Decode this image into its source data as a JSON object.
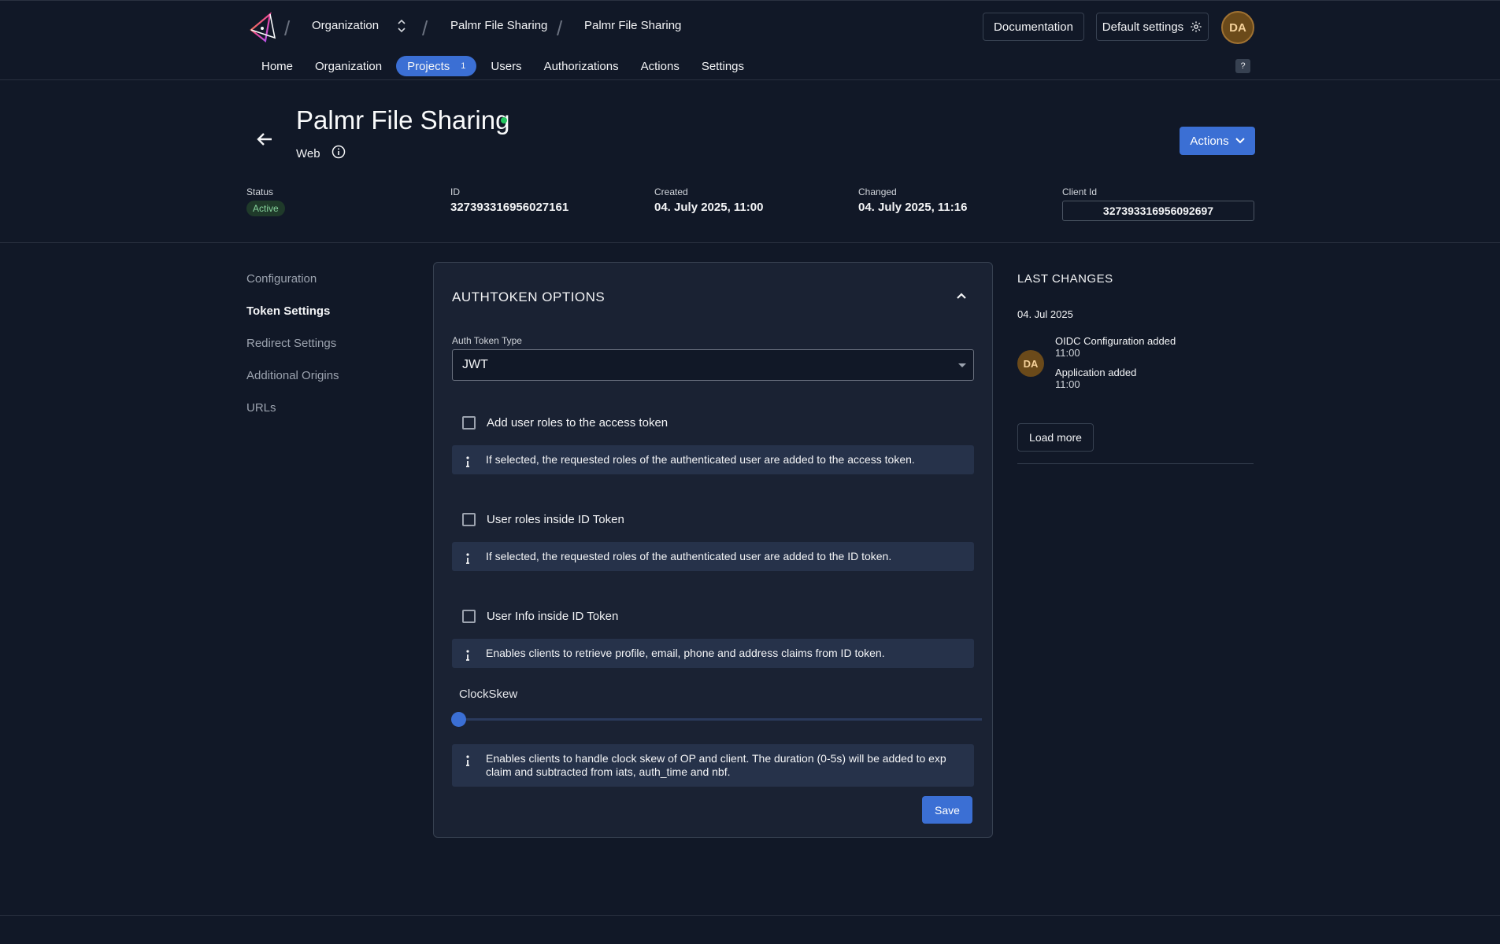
{
  "topbar": {
    "breadcrumb": [
      "Organization",
      "Palmr File Sharing",
      "Palmr File Sharing"
    ],
    "documentation_label": "Documentation",
    "default_settings_label": "Default settings",
    "avatar_initials": "DA"
  },
  "nav": {
    "items": [
      "Home",
      "Organization",
      "Projects",
      "Users",
      "Authorizations",
      "Actions",
      "Settings"
    ],
    "projects_count": "1",
    "help_label": "?"
  },
  "header": {
    "title": "Palmr File Sharing",
    "subtype": "Web",
    "actions_label": "Actions"
  },
  "meta": {
    "status_label": "Status",
    "status_value": "Active",
    "id_label": "ID",
    "id_value": "327393316956027161",
    "created_label": "Created",
    "created_value": "04. July 2025, 11:00",
    "changed_label": "Changed",
    "changed_value": "04. July 2025, 11:16",
    "client_id_label": "Client Id",
    "client_id_value": "327393316956092697"
  },
  "sidenav": {
    "items": [
      "Configuration",
      "Token Settings",
      "Redirect Settings",
      "Additional Origins",
      "URLs"
    ],
    "active": "Token Settings"
  },
  "card": {
    "title": "AUTHTOKEN OPTIONS",
    "auth_token_type_label": "Auth Token Type",
    "auth_token_type_value": "JWT",
    "options": [
      {
        "label": "Add user roles to the access token",
        "checked": false,
        "hint": "If selected, the requested roles of the authenticated user are added to the access token."
      },
      {
        "label": "User roles inside ID Token",
        "checked": false,
        "hint": "If selected, the requested roles of the authenticated user are added to the ID token."
      },
      {
        "label": "User Info inside ID Token",
        "checked": false,
        "hint": "Enables clients to retrieve profile, email, phone and address claims from ID token."
      }
    ],
    "clockskew_label": "ClockSkew",
    "clockskew_value": 0,
    "clockskew_hint": "Enables clients to handle clock skew of OP and client. The duration (0-5s) will be added to exp claim and subtracted from iats, auth_time and nbf.",
    "save_label": "Save"
  },
  "changes": {
    "title": "LAST CHANGES",
    "date": "04. Jul 2025",
    "avatar_initials": "DA",
    "items": [
      {
        "text": "OIDC Configuration added",
        "time": "11:00"
      },
      {
        "text": "Application added",
        "time": "11:00"
      }
    ],
    "load_more_label": "Load more"
  },
  "colors": {
    "accent": "#3b6fd4",
    "status_green": "#22c55e",
    "background": "#111827"
  }
}
